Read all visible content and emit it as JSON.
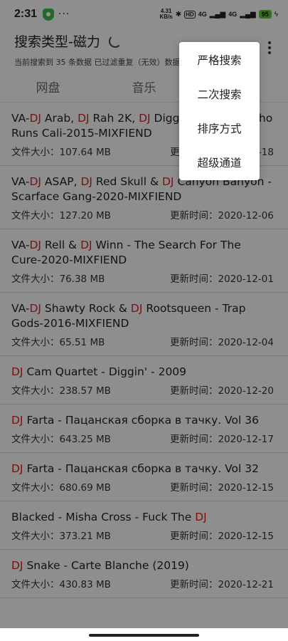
{
  "status_bar": {
    "time": "2:31",
    "dots": "···",
    "net_speed_value": "4.31",
    "net_speed_unit": "KB/s",
    "hd": "HD",
    "signal1": "4G",
    "signal2": "4G",
    "battery": "95"
  },
  "header": {
    "title": "搜索类型-磁力",
    "subtitle": "当前搜索到 35 条数据 已过滤重复（无效）数据"
  },
  "tabs": [
    "网盘",
    "音乐",
    ""
  ],
  "items": [
    {
      "title_parts": [
        {
          "t": "VA-"
        },
        {
          "t": "DJ",
          "h": true
        },
        {
          "t": " Arab, "
        },
        {
          "t": "DJ",
          "h": true
        },
        {
          "t": " Rah 2K, "
        },
        {
          "t": "DJ",
          "h": true
        },
        {
          "t": " Diggz Montana - Who Runs Cali-2015-MIXFIEND"
        }
      ],
      "size": "文件大小：107.64 MB",
      "date": "更新时间：2020-12-18"
    },
    {
      "title_parts": [
        {
          "t": "VA-"
        },
        {
          "t": "DJ",
          "h": true
        },
        {
          "t": " ASAP, "
        },
        {
          "t": "DJ",
          "h": true
        },
        {
          "t": " Red Skull & "
        },
        {
          "t": "DJ",
          "h": true
        },
        {
          "t": " Canyon Banyon - Scarface Gang-2020-MIXFIEND"
        }
      ],
      "size": "文件大小：127.20 MB",
      "date": "更新时间：2020-12-06"
    },
    {
      "title_parts": [
        {
          "t": "VA-"
        },
        {
          "t": "DJ",
          "h": true
        },
        {
          "t": " Rell & "
        },
        {
          "t": "DJ",
          "h": true
        },
        {
          "t": " Winn - The Search For The Cure-2020-MIXFIEND"
        }
      ],
      "size": "文件大小：76.38 MB",
      "date": "更新时间：2020-12-01"
    },
    {
      "title_parts": [
        {
          "t": "VA-"
        },
        {
          "t": "DJ",
          "h": true
        },
        {
          "t": " Shawty Rock & "
        },
        {
          "t": "DJ",
          "h": true
        },
        {
          "t": " Rootsqueen - Trap Gods-2016-MIXFIEND"
        }
      ],
      "size": "文件大小：65.51 MB",
      "date": "更新时间：2020-12-04"
    },
    {
      "title_parts": [
        {
          "t": "DJ",
          "h": true
        },
        {
          "t": " Cam Quartet - Diggin' - 2009"
        }
      ],
      "size": "文件大小：238.57 MB",
      "date": "更新时间：2020-12-20"
    },
    {
      "title_parts": [
        {
          "t": "DJ",
          "h": true
        },
        {
          "t": " Farta - Пацанская сборка в тачку. Vol 36"
        }
      ],
      "size": "文件大小：643.25 MB",
      "date": "更新时间：2020-12-17"
    },
    {
      "title_parts": [
        {
          "t": "DJ",
          "h": true
        },
        {
          "t": " Farta - Пацанская сборка в тачку. Vol 32"
        }
      ],
      "size": "文件大小：680.69 MB",
      "date": "更新时间：2020-12-15"
    },
    {
      "title_parts": [
        {
          "t": "Blacked - Misha Cross - Fuck The "
        },
        {
          "t": "DJ",
          "h": true
        }
      ],
      "size": "文件大小：373.21 MB",
      "date": "更新时间：2020-12-15"
    },
    {
      "title_parts": [
        {
          "t": "DJ",
          "h": true
        },
        {
          "t": " Snake - Carte Blanche (2019)"
        }
      ],
      "size": "文件大小：430.83 MB",
      "date": "更新时间：2020-12-21"
    }
  ],
  "menu": [
    "严格搜索",
    "二次搜索",
    "排序方式",
    "超级通道"
  ],
  "colors": {
    "highlight": "#d41f1f",
    "battery": "#59c32a",
    "shield": "#3bb54a"
  },
  "icons": [
    "shield-icon",
    "spinner-icon",
    "more-vert-icon"
  ]
}
